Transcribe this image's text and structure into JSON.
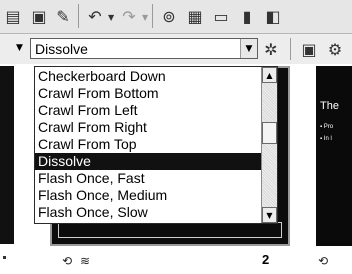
{
  "toolbar": {
    "icons": [
      "paste-icon",
      "copy-format-icon",
      "format-painter-icon",
      "undo-icon",
      "redo-icon",
      "hyperlink-icon",
      "tables-borders-icon",
      "insert-table-icon",
      "insert-chart-icon",
      "new-slide-icon"
    ]
  },
  "transition": {
    "selected_value": "Dissolve"
  },
  "dropdown": {
    "items": [
      "Checkerboard Down",
      "Crawl From Bottom",
      "Crawl From Left",
      "Crawl From Right",
      "Crawl From Top",
      "Dissolve",
      "Flash Once, Fast",
      "Flash Once, Medium",
      "Flash Once, Slow"
    ],
    "selected_index": 5
  },
  "slides": {
    "right_slide_title_partial": "The",
    "right_slide_bullet_1": "▪ Pro",
    "right_slide_bullet_2": "▪ In l",
    "slide_number": "2"
  }
}
